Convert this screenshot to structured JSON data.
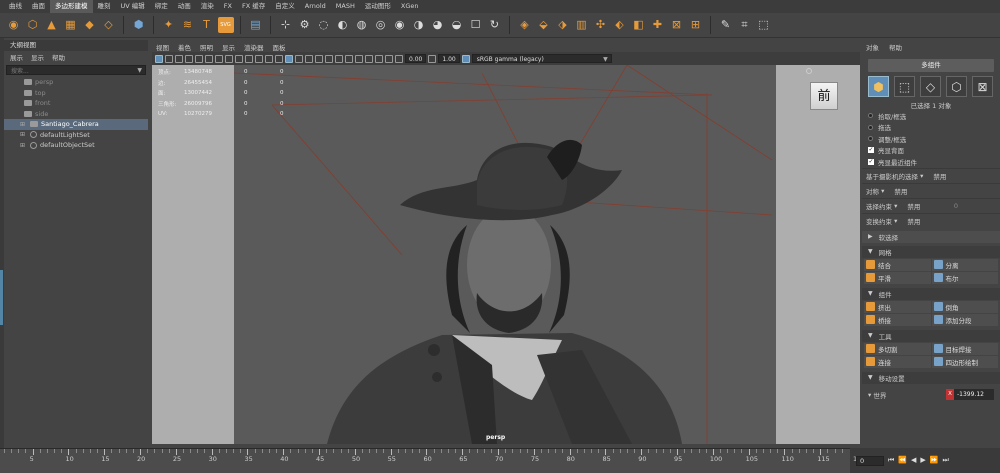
{
  "menu_tabs": [
    "曲线",
    "曲面",
    "多边形建模",
    "雕刻",
    "UV 编辑",
    "绑定",
    "动画",
    "渲染",
    "FX",
    "FX 缓存",
    "自定义",
    "Arnold",
    "MASH",
    "运动图形",
    "XGen"
  ],
  "menu_tabs_active": "多边形建模",
  "shelf": {
    "group1": [
      "cube-icon",
      "cylinder-icon",
      "cone-icon",
      "plane-icon",
      "torus-icon",
      "disc-icon"
    ],
    "icon_chars1": [
      "◉",
      "⬡",
      "▲",
      "▦",
      "◆",
      "◇"
    ],
    "group2": [
      "sphere-icon"
    ],
    "icon_chars2": [
      "⬢"
    ],
    "group3": [
      "sparkle-icon",
      "sweep-icon",
      "text-icon",
      "svg-icon"
    ],
    "icon_chars3": [
      "✦",
      "≋",
      "T",
      "▣"
    ],
    "group4": [
      "uv-layout-icon"
    ],
    "icon_chars4": [
      "▤"
    ],
    "group5": [
      "mirror-icon",
      "pivot-icon",
      "count-icon",
      "center-icon",
      "bevel-icon",
      "combine-icon",
      "separate-icon",
      "extract-icon",
      "smooth-icon",
      "boolean-icon",
      "bridge-icon",
      "reduce-icon"
    ],
    "icon_chars5": [
      "⊹",
      "⚙",
      "◌",
      "◐",
      "◍",
      "◎",
      "◉",
      "◑",
      "◕",
      "◒",
      "☐",
      "↻"
    ],
    "group6": [
      "extrude-icon",
      "append-icon",
      "fill-hole-icon",
      "insert-loop-icon",
      "merge-icon",
      "poke-icon",
      "wedge-icon",
      "target-weld-icon",
      "offset-loop-icon",
      "multi-cut-icon"
    ],
    "icon_chars6": [
      "◈",
      "⬙",
      "⬗",
      "▥",
      "✣",
      "⬖",
      "◧",
      "✚",
      "⊠",
      "⊞"
    ],
    "group7": [
      "pencil-icon",
      "edit-icon",
      "crop-icon"
    ],
    "icon_chars7": [
      "✎",
      "⌗",
      "⬚"
    ],
    "svg_label": "SVG",
    "count_label": "0,0,0"
  },
  "outliner": {
    "title": "大纲视图",
    "menus": [
      "展示",
      "显示",
      "帮助"
    ],
    "search_placeholder": "搜索...",
    "items": [
      {
        "label": "persp",
        "kind": "camera",
        "dim": true
      },
      {
        "label": "top",
        "kind": "camera",
        "dim": true
      },
      {
        "label": "front",
        "kind": "camera",
        "dim": true
      },
      {
        "label": "side",
        "kind": "camera",
        "dim": true
      },
      {
        "label": "Santiago_Cabrera",
        "kind": "mesh",
        "selected": true
      },
      {
        "label": "defaultLightSet",
        "kind": "set"
      },
      {
        "label": "defaultObjectSet",
        "kind": "set"
      }
    ]
  },
  "viewport": {
    "menus": [
      "视图",
      "着色",
      "照明",
      "显示",
      "渲染器",
      "面板"
    ],
    "exposure_value": "0.00",
    "gamma_value": "1.00",
    "color_space": "sRGB gamma (legacy)",
    "camera_label": "persp",
    "viewcube_label": "前",
    "hud": [
      {
        "label": "顶点:",
        "value": "13480748",
        "a": "0",
        "b": "0"
      },
      {
        "label": "边:",
        "value": "26455454",
        "a": "0",
        "b": "0"
      },
      {
        "label": "面:",
        "value": "13007442",
        "a": "0",
        "b": "0"
      },
      {
        "label": "三角形:",
        "value": "26009796",
        "a": "0",
        "b": "0"
      },
      {
        "label": "UV:",
        "value": "10270279",
        "a": "0",
        "b": "0"
      }
    ]
  },
  "right_panel": {
    "menus": [
      "对象",
      "帮助"
    ],
    "component_button": "多组件",
    "selection_info": "已选择 1 对象",
    "pick_options": [
      {
        "label": "拾取/框选",
        "type": "radio",
        "on": false
      },
      {
        "label": "拖选",
        "type": "radio",
        "on": false
      },
      {
        "label": "调整/框选",
        "type": "radio",
        "on": false
      },
      {
        "label": "亮显背面",
        "type": "check",
        "on": true
      },
      {
        "label": "亮显最近组件",
        "type": "check",
        "on": true
      }
    ],
    "camera_selection": {
      "label": "基于摄影机的选择",
      "value": "禁用"
    },
    "symmetry": {
      "label": "对称",
      "value": "禁用"
    },
    "select_constraint": {
      "label": "选择约束",
      "value": "禁用",
      "num": "0"
    },
    "transform_constraint": {
      "label": "变换约束",
      "value": "禁用"
    },
    "soft_select": "软选择",
    "mesh_section": {
      "title": "网格",
      "tools": [
        {
          "label": "结合",
          "icon": "combine-icon"
        },
        {
          "label": "分离",
          "icon": "separate-icon"
        },
        {
          "label": "平滑",
          "icon": "smooth-icon"
        },
        {
          "label": "布尔",
          "icon": "boolean-icon"
        }
      ]
    },
    "component_section": {
      "title": "组件",
      "tools": [
        {
          "label": "挤出",
          "icon": "extrude-icon"
        },
        {
          "label": "倒角",
          "icon": "bevel-icon"
        },
        {
          "label": "桥接",
          "icon": "bridge-icon"
        },
        {
          "label": "添加分段",
          "icon": "add-divisions-icon"
        }
      ]
    },
    "tools_section": {
      "title": "工具",
      "tools": [
        {
          "label": "多切割",
          "icon": "multi-cut-icon"
        },
        {
          "label": "目标焊接",
          "icon": "target-weld-icon"
        },
        {
          "label": "连接",
          "icon": "connect-icon"
        },
        {
          "label": "四边形绘制",
          "icon": "quad-draw-icon"
        }
      ]
    },
    "move_settings": "移动设置",
    "world": {
      "label": "世界",
      "axis": "X",
      "value": "-1399.12"
    }
  },
  "timeline": {
    "ticks": [
      "5",
      "10",
      "15",
      "20",
      "25",
      "30",
      "35",
      "40",
      "45",
      "50",
      "55",
      "60",
      "65",
      "70",
      "75",
      "80",
      "85",
      "90",
      "95",
      "100",
      "105",
      "110",
      "115",
      "12"
    ],
    "current_frame": "0",
    "controls": [
      "⏮",
      "⏪",
      "◀",
      "▶",
      "⏩",
      "⏭"
    ]
  },
  "colors": {
    "accent_blue": "#5f8fb8",
    "shelf_orange": "#e69a3a",
    "selection_row": "#5a6a7c",
    "axis_x_red": "#c23232"
  }
}
